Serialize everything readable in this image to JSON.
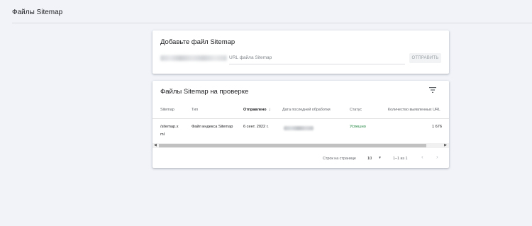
{
  "page": {
    "title": "Файлы Sitemap"
  },
  "add_sitemap": {
    "title": "Добавьте файл Sitemap",
    "url_placeholder": "URL файла Sitemap",
    "submit_label": "ОТПРАВИТЬ"
  },
  "sitemaps_list": {
    "title": "Файлы Sitemap на проверке",
    "filter_icon": "filter-icon",
    "columns": [
      "Sitemap",
      "Тип",
      "Отправлено",
      "Дата последней обработки",
      "Статус",
      "Количество выявленных URL"
    ],
    "sort_arrow": "↓",
    "rows": [
      {
        "sitemap_line1": "/sitemap.x",
        "sitemap_line2": "ml",
        "type": "Файл индекса Sitemap",
        "submitted": "6 сент. 2022 г.",
        "status": "Успешно",
        "urls": "1 676"
      }
    ],
    "footer": {
      "rows_per_page_label": "Строк на странице",
      "rows_per_page_value": "10",
      "range_label": "1–1 из 1"
    }
  },
  "colors": {
    "status_success": "#188038",
    "background": "#f1f3f9"
  }
}
